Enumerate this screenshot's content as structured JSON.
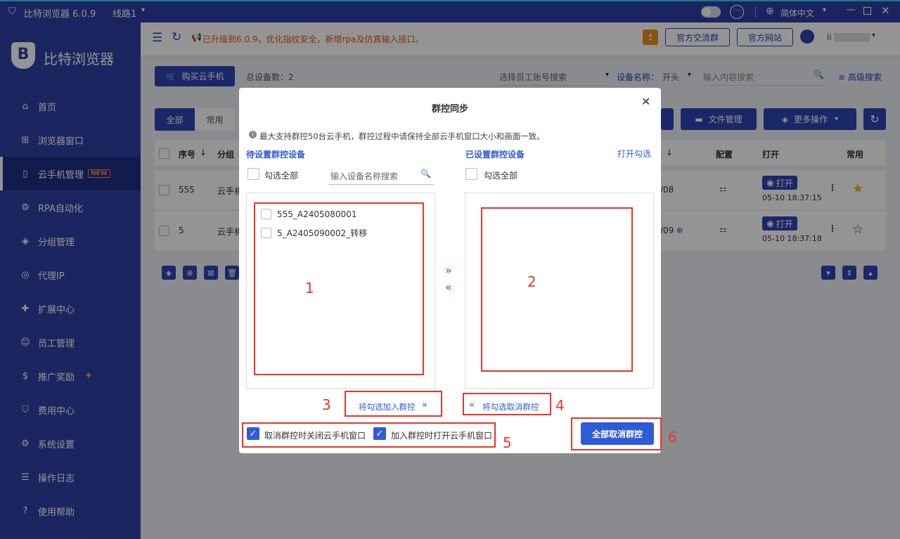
{
  "titlebar": {
    "app_title": "比特浏览器 6.0.9",
    "route": "线路1",
    "language": "简体中文"
  },
  "sidebar": {
    "brand": "比特浏览器",
    "items": [
      {
        "label": "首页",
        "icon": "home-icon"
      },
      {
        "label": "浏览器窗口",
        "icon": "grid-icon"
      },
      {
        "label": "云手机管理",
        "icon": "phone-icon",
        "badge": "NEW"
      },
      {
        "label": "RPA自动化",
        "icon": "robot-icon"
      },
      {
        "label": "分组管理",
        "icon": "layers-icon"
      },
      {
        "label": "代理IP",
        "icon": "location-icon"
      },
      {
        "label": "扩展中心",
        "icon": "puzzle-icon"
      },
      {
        "label": "员工管理",
        "icon": "users-icon"
      },
      {
        "label": "推广奖励",
        "icon": "coin-icon"
      },
      {
        "label": "费用中心",
        "icon": "shield-yen-icon"
      },
      {
        "label": "系统设置",
        "icon": "gear-icon"
      },
      {
        "label": "操作日志",
        "icon": "log-icon"
      },
      {
        "label": "使用帮助",
        "icon": "help-icon"
      }
    ]
  },
  "topbar": {
    "notice": "已升级到6.0.9，优化指纹安全，新增rpa及仿真输入接口。",
    "group_button": "官方交流群",
    "website_button": "官方网站",
    "user_name": "li"
  },
  "toolbar": {
    "buy_button": "购买云手机",
    "total_label": "总设备数：2",
    "employee_placeholder": "选择员工账号搜索",
    "device_name_label": "设备名称：",
    "match_mode": "开头",
    "search_placeholder": "输入内容搜索",
    "advanced_search": "高级搜索"
  },
  "tabs": {
    "all": "全部",
    "common": "常用"
  },
  "actions": {
    "file_manage": "文件管理",
    "more_actions": "更多操作"
  },
  "table": {
    "headers": {
      "seq": "序号",
      "group": "分组",
      "config": "配置",
      "open": "打开",
      "favorite": "常用"
    },
    "rows": [
      {
        "seq": "555",
        "group": "云手机",
        "date": "/08",
        "open_label": "打开",
        "time": "05-10 18:37:15",
        "favorite": true
      },
      {
        "seq": "5",
        "group": "云手机",
        "date": "/09",
        "open_label": "打开",
        "time": "05-10 18:37:18",
        "favorite": false
      }
    ]
  },
  "modal": {
    "title": "群控同步",
    "info": "最大支持群控50台云手机，群控过程中请保持全部云手机窗口大小和画面一致。",
    "left_title": "待设置群控设备",
    "right_title": "已设置群控设备",
    "open_selected": "打开勾选",
    "select_all": "勾选全部",
    "search_placeholder": "输入设备名称搜索",
    "left_items": [
      "555_A2405080001",
      "5_A2405090002_转移"
    ],
    "add_button": "将勾选加入群控",
    "remove_button": "将勾选取消群控",
    "option_close": "取消群控时关闭云手机窗口",
    "option_open": "加入群控时打开云手机窗口",
    "cancel_all": "全部取消群控"
  },
  "annotations": [
    "1",
    "2",
    "3",
    "4",
    "5",
    "6"
  ],
  "colors": {
    "sidebar": "#2f42a8",
    "primary": "#2e44b4",
    "accent_red": "#e8352d",
    "notice": "#e8531f"
  }
}
